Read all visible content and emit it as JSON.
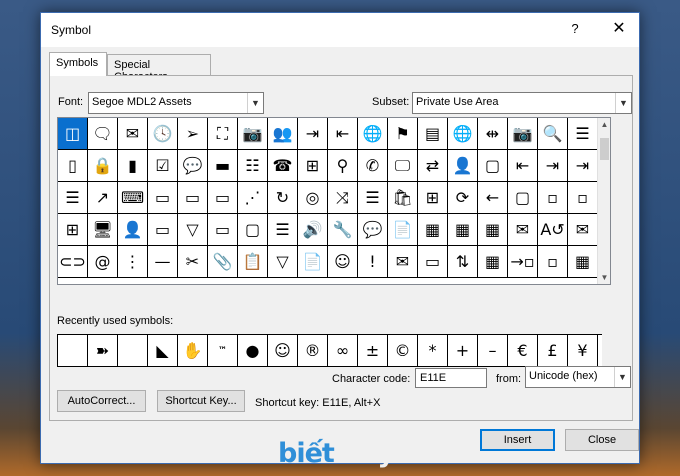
{
  "window": {
    "title": "Symbol",
    "help_label": "?",
    "close_label": "✕"
  },
  "tabs": {
    "symbols": "Symbols",
    "special": "Special Characters"
  },
  "font": {
    "label": "Font:",
    "value": "Segoe MDL2 Assets"
  },
  "subset": {
    "label": "Subset:",
    "value": "Private Use Area"
  },
  "grid": {
    "rows": [
      [
        "◫",
        "🗨",
        "✉",
        "🕓",
        "➢",
        "⛶",
        "📷",
        "👥",
        "⇥",
        "⇤",
        "🌐",
        "⚑",
        "▤",
        "🌐",
        "⇹",
        "📷",
        "🔍",
        "☰"
      ],
      [
        "▯",
        "🔒",
        "▮",
        "☑",
        "💬",
        "▬",
        "☷",
        "☎",
        "⊞",
        "⚲",
        "✆",
        "🖵",
        "⇄",
        "👤",
        "▢",
        "⇤",
        "⇥",
        "⇥"
      ],
      [
        "☰",
        "↗",
        "⌨",
        "▭",
        "▭",
        "▭",
        "⋰",
        "↻",
        "◎",
        "⤨",
        "☰",
        "🛍",
        "⊞",
        "⟳",
        "←",
        "▢",
        "▫",
        "▫"
      ],
      [
        "⊞",
        "🖥",
        "👤",
        "▭",
        "▽",
        "▭",
        "▢",
        "☰",
        "🔊",
        "🔧",
        "💬",
        "📄",
        "▦",
        "▦",
        "▦",
        "✉",
        "A↺",
        "✉"
      ],
      [
        "⊂⊃",
        "@",
        "⋮",
        "—",
        "✂",
        "📎",
        "📋",
        "▽",
        "📄",
        "☺",
        "!",
        "✉",
        "▭",
        "⇅",
        "▦",
        "→▫",
        "▫",
        "▦"
      ]
    ]
  },
  "recent": {
    "label": "Recently used symbols:",
    "items": [
      "",
      "➽",
      "",
      "◣",
      "✋",
      "™",
      "●",
      "☺",
      "®",
      "∞",
      "±",
      "©",
      "*",
      "+",
      "–",
      "€",
      "£",
      "¥"
    ]
  },
  "char_code": {
    "label": "Character code:",
    "value": "E11E"
  },
  "from": {
    "label": "from:",
    "value": "Unicode (hex)"
  },
  "buttons": {
    "autocorrect": "AutoCorrect...",
    "shortcut_key": "Shortcut Key...",
    "insert": "Insert",
    "close": "Close"
  },
  "shortcut_text": "Shortcut key: E11E, Alt+X",
  "watermark": {
    "part1": "biết",
    "part2": "máytính"
  }
}
